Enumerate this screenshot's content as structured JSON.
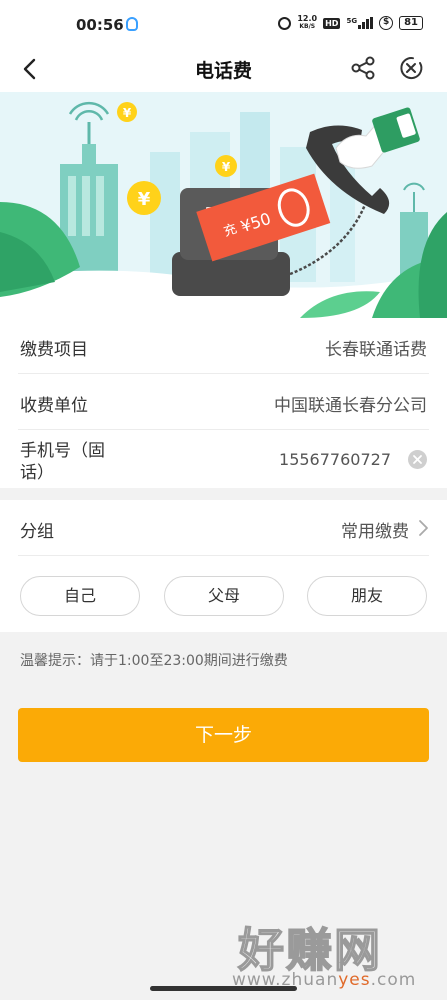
{
  "status_bar": {
    "time": "00:56",
    "speed_value": "12.0",
    "speed_unit": "KB/S",
    "hd": "HD",
    "network": "5G",
    "battery": "81"
  },
  "nav": {
    "title": "电话费"
  },
  "banner": {
    "voucher_char": "充",
    "voucher_value": "¥50",
    "coin_symbol": "¥"
  },
  "form": {
    "item_label": "缴费项目",
    "item_value": "长春联通话费",
    "unit_label": "收费单位",
    "unit_value": "中国联通长春分公司",
    "phone_label": "手机号（固话）",
    "phone_value": "15567760727"
  },
  "group": {
    "label": "分组",
    "value": "常用缴费",
    "options": [
      "自己",
      "父母",
      "朋友"
    ]
  },
  "tip": "温馨提示：请于1:00至23:00期间进行缴费",
  "next_button": "下一步",
  "watermark": {
    "big": "好赚网",
    "small_a": "www.zhuan",
    "small_b": "yes",
    "small_c": ".com"
  },
  "colors": {
    "accent": "#fbaa06",
    "banner_bg": "#e6f6f9",
    "voucher": "#f25a3c",
    "leaf": "#3fb877"
  }
}
